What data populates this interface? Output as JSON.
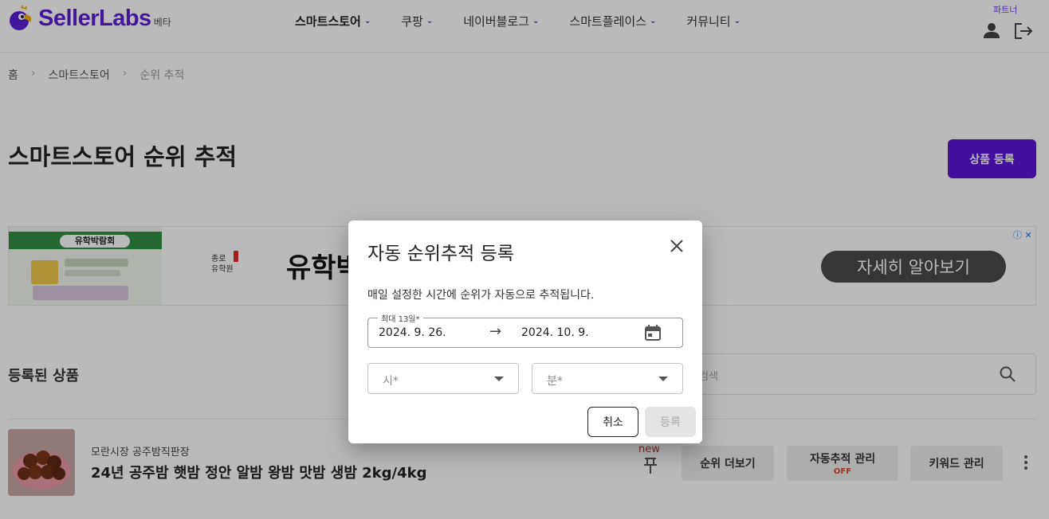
{
  "header": {
    "brand": "SellerLabs",
    "beta": "베타",
    "nav": [
      {
        "label": "스마트스토어"
      },
      {
        "label": "쿠팡"
      },
      {
        "label": "네이버블로그"
      },
      {
        "label": "스마트플레이스"
      },
      {
        "label": "커뮤니티"
      }
    ],
    "partner": "파트너",
    "accent": "#5b1fd6"
  },
  "breadcrumb": [
    "홈",
    "스마트스토어",
    "순위 추적"
  ],
  "page": {
    "title": "스마트스토어 순위 추적",
    "register_button": "상품 등록"
  },
  "ad": {
    "thumb_title": "유학박람회",
    "logo": "종로\n유학원",
    "headline": "유학박",
    "cta": "자세히 알아보기"
  },
  "products": {
    "section_title": "등록된 상품",
    "search_placeholder": "검색",
    "items": [
      {
        "store": "모란시장 공주밤직판장",
        "name": "24년 공주밤 햇밤 정안 알밤 왕밤 맛밤 생밤 2kg/4kg",
        "new_label": "new",
        "rank_more": "순위 더보기",
        "auto_track": "자동추적 관리",
        "auto_track_status": "OFF",
        "keyword_manage": "키워드 관리"
      }
    ]
  },
  "dialog": {
    "title": "자동 순위추적 등록",
    "description": "매일 설정한 시간에 순위가 자동으로 추적됩니다.",
    "date_label": "최대 13일*",
    "start_date": "2024. 9. 26.",
    "arrow": "→",
    "end_date": "2024. 10. 9.",
    "hour_placeholder": "시*",
    "minute_placeholder": "분*",
    "cancel": "취소",
    "submit": "등록"
  }
}
